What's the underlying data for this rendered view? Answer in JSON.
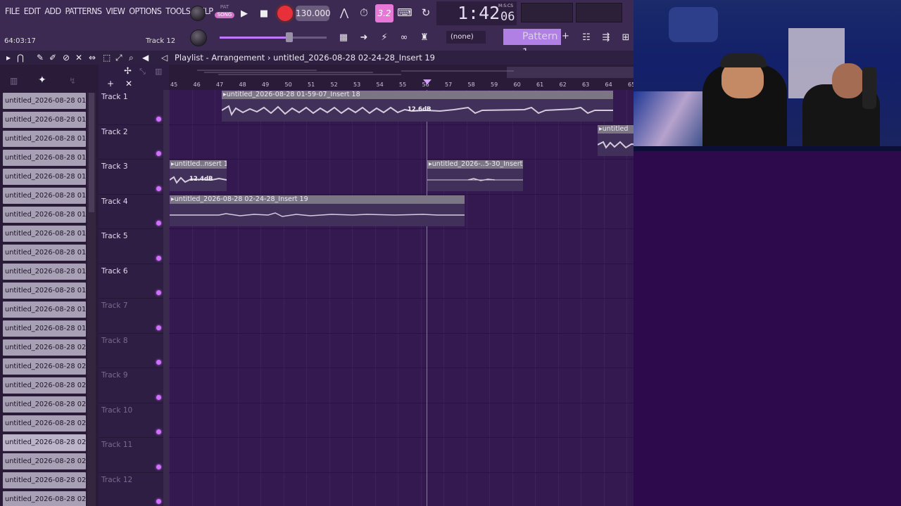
{
  "menu": [
    "FILE",
    "EDIT",
    "ADD",
    "PATTERNS",
    "VIEW",
    "OPTIONS",
    "TOOLS",
    "HELP"
  ],
  "hint": {
    "time": "64:03:17",
    "track": "Track 12"
  },
  "transport": {
    "pat_label": "PAT",
    "song_label": "SONG",
    "tempo": "130.000",
    "step_value": "3.2"
  },
  "clock": {
    "main": "1:42",
    "sub": "06",
    "unit": "M:S:CS"
  },
  "channel": {
    "none_label": "(none)",
    "pattern_label": "Pattern 1",
    "add_label": "+"
  },
  "playlist": {
    "title": "Playlist - Arrangement",
    "separator": "›",
    "current": "untitled_2026-08-28 02-24-28_Insert 19"
  },
  "ruler_ticks": [
    "45",
    "46",
    "47",
    "48",
    "49",
    "50",
    "51",
    "52",
    "53",
    "54",
    "55",
    "56",
    "57",
    "58",
    "59",
    "60",
    "61",
    "62",
    "63",
    "64",
    "65"
  ],
  "clip_list": [
    "untitled_2026-08-28 01-...",
    "untitled_2026-08-28 01-...",
    "untitled_2026-08-28 01-...",
    "untitled_2026-08-28 01-...",
    "untitled_2026-08-28 01-...",
    "untitled_2026-08-28 01-...",
    "untitled_2026-08-28 01-...",
    "untitled_2026-08-28 01-...",
    "untitled_2026-08-28 01-...",
    "untitled_2026-08-28 01-...",
    "untitled_2026-08-28 01-...",
    "untitled_2026-08-28 01-...",
    "untitled_2026-08-28 01-...",
    "untitled_2026-08-28 02-...",
    "untitled_2026-08-28 02-...",
    "untitled_2026-08-28 02-...",
    "untitled_2026-08-28 02-...",
    "untitled_2026-08-28 02-...",
    "untitled_2026-08-28 02-...",
    "untitled_2026-08-28 02-...",
    "untitled_2026-08-28 02-...",
    "untitled_2026-08-28 02-..."
  ],
  "tracks": [
    "Track 1",
    "Track 2",
    "Track 3",
    "Track 4",
    "Track 5",
    "Track 6",
    "Track 7",
    "Track 8",
    "Track 9",
    "Track 10",
    "Track 11",
    "Track 12"
  ],
  "clips": {
    "t1": {
      "label": "untitled_2026-08-28 01-59-07_Insert 18",
      "gain": "12.6dB"
    },
    "t2": {
      "label": "untitled"
    },
    "t3a": {
      "label": "untitled..nsert 18",
      "gain": "12.4dB"
    },
    "t3b": {
      "label": "untitled_2026-..5-30_Insert 19"
    },
    "t4": {
      "label": "untitled_2026-08-28 02-24-28_Insert 19"
    }
  },
  "colors": {
    "accent": "#d070ff",
    "song": "#d070c8",
    "record": "#e8303a",
    "grid": "#331950",
    "clip_header": "#7c7584"
  },
  "icons": [
    "magnet-icon",
    "pencil-icon",
    "brush-icon",
    "delete-icon",
    "mute-icon",
    "slip-icon",
    "select-icon",
    "zoom-icon",
    "playback-icon",
    "speaker-icon",
    "play-icon",
    "stop-icon",
    "record-icon",
    "metronome-icon",
    "link-icon",
    "stamp-icon",
    "piano-icon",
    "arrow-icon",
    "plugin-icon",
    "mixer-icon",
    "browser-icon"
  ]
}
